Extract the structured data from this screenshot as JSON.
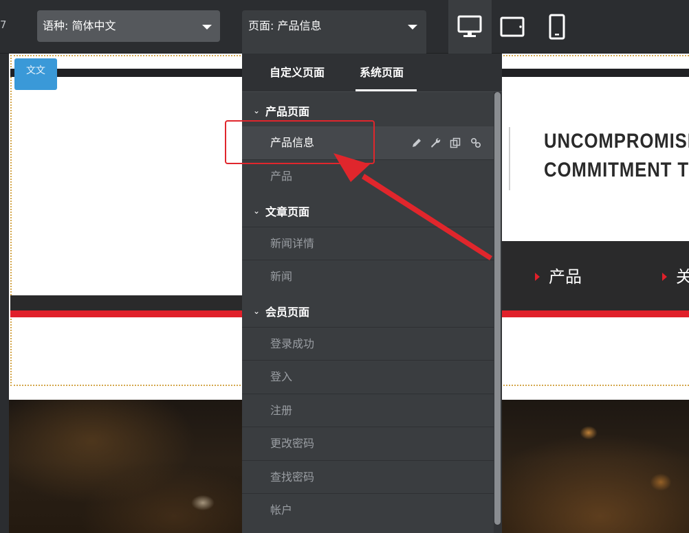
{
  "toolbar": {
    "left_edge_glyph": "7",
    "language_select": {
      "label": "语种:",
      "value": "简体中文"
    },
    "page_select": {
      "label": "页面:",
      "value": "产品信息"
    },
    "devices": [
      "desktop-icon",
      "tablet-icon",
      "mobile-icon"
    ]
  },
  "dropdown": {
    "tabs": [
      {
        "label": "自定义页面",
        "active": false
      },
      {
        "label": "系统页面",
        "active": true
      }
    ],
    "groups": [
      {
        "title": "产品页面",
        "items": [
          {
            "label": "产品信息",
            "selected": true
          },
          {
            "label": "产品",
            "selected": false
          }
        ]
      },
      {
        "title": "文章页面",
        "items": [
          {
            "label": "新闻详情",
            "selected": false
          },
          {
            "label": "新闻",
            "selected": false
          }
        ]
      },
      {
        "title": "会员页面",
        "items": [
          {
            "label": "登录成功",
            "selected": false
          },
          {
            "label": "登入",
            "selected": false
          },
          {
            "label": "注册",
            "selected": false
          },
          {
            "label": "更改密码",
            "selected": false
          },
          {
            "label": "查找密码",
            "selected": false
          },
          {
            "label": "帐户",
            "selected": false
          }
        ]
      }
    ],
    "item_tools": [
      "pencil-icon",
      "wrench-icon",
      "copy-icon",
      "link-icon"
    ]
  },
  "preview": {
    "lang_badge_text": "文文",
    "tagline": [
      "UNCOMPROMISI",
      "COMMITMENT TO"
    ],
    "nav_items": [
      "产品",
      "关"
    ]
  },
  "colors": {
    "toolbar_bg": "#2b2d30",
    "dropdown_bg": "#3a3d40",
    "accent_red": "#e0202a",
    "badge_blue": "#3a99d8",
    "annotation_red": "#e0262c"
  }
}
